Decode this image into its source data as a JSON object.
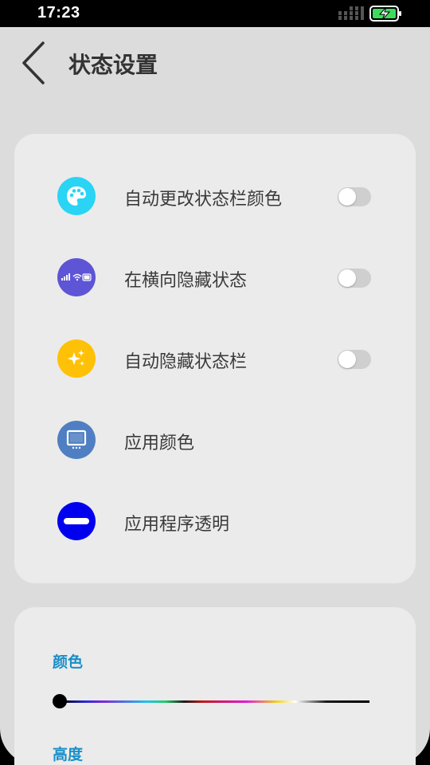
{
  "status_bar": {
    "time": "17:23"
  },
  "header": {
    "title": "状态设置"
  },
  "settings": [
    {
      "label": "自动更改状态栏颜色",
      "icon": "palette-icon",
      "icon_color": "#2ad4f5",
      "toggle": false
    },
    {
      "label": "在横向隐藏状态",
      "icon": "statusbar-icon",
      "icon_color": "#5d55d6",
      "toggle": false
    },
    {
      "label": "自动隐藏状态栏",
      "icon": "sparkles-icon",
      "icon_color": "#ffc107",
      "toggle": false
    },
    {
      "label": "应用颜色",
      "icon": "monitor-icon",
      "icon_color": "#4f7fc2"
    },
    {
      "label": "应用程序透明",
      "icon": "minus-circle-icon",
      "icon_color": "#0000ee"
    }
  ],
  "appearance": {
    "color_label": "颜色",
    "color_slider_value": 0,
    "height_label": "高度"
  }
}
